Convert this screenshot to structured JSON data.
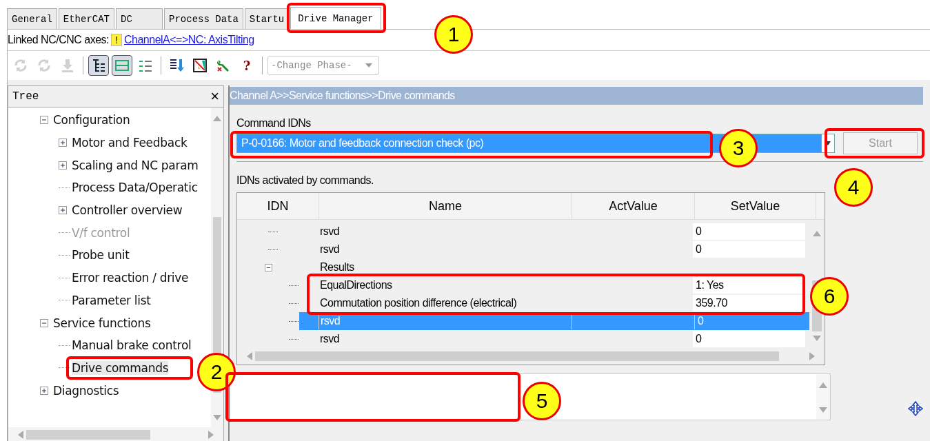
{
  "tabs": [
    {
      "label": "General",
      "selected": false
    },
    {
      "label": "EtherCAT",
      "selected": false
    },
    {
      "label": "DC",
      "selected": false
    },
    {
      "label": "Process Data",
      "selected": false
    },
    {
      "label": "Startu",
      "selected": false
    },
    {
      "label": "Drive Manager",
      "selected": true
    }
  ],
  "linked": {
    "label": "Linked NC/CNC axes:",
    "badge": "!",
    "link": "ChannelA<=>NC: AxisTilting"
  },
  "toolbar": {
    "buttons": [
      {
        "kind": "refresh",
        "disabled": true
      },
      {
        "kind": "reload",
        "disabled": true
      },
      {
        "kind": "download",
        "disabled": true
      },
      {
        "kind": "sep"
      },
      {
        "kind": "tree",
        "disabled": false,
        "pressed": true
      },
      {
        "kind": "list",
        "disabled": false,
        "pressed": true
      },
      {
        "kind": "checklist",
        "disabled": false
      },
      {
        "kind": "sep"
      },
      {
        "kind": "sort",
        "disabled": false
      },
      {
        "kind": "chart",
        "disabled": false
      },
      {
        "kind": "wrench",
        "disabled": false
      },
      {
        "kind": "help",
        "label": "?",
        "disabled": false
      },
      {
        "kind": "sep"
      }
    ],
    "phase": {
      "placeholder": "-Change Phase-",
      "disabled": true
    }
  },
  "tree": {
    "title": "Tree",
    "close": "×",
    "items": [
      {
        "label": "Configuration",
        "expanded": true,
        "children": [
          {
            "label": "Motor and Feedback",
            "expanded": false
          },
          {
            "label": "Scaling and NC param",
            "expanded": false
          },
          {
            "label": "Process Data/Operatic"
          },
          {
            "label": "Controller overview",
            "expanded": false
          },
          {
            "label": "V/f control",
            "disabled": true
          },
          {
            "label": "Probe unit"
          },
          {
            "label": "Error reaction / drive"
          },
          {
            "label": "Parameter list"
          }
        ]
      },
      {
        "label": "Service functions",
        "expanded": true,
        "children": [
          {
            "label": "Manual brake control",
            "selected": false
          },
          {
            "label": "Drive commands",
            "selected": true
          }
        ]
      },
      {
        "label": "Diagnostics",
        "expanded": false
      }
    ]
  },
  "panel": {
    "breadcrumb": "Channel A>>Service functions>>Drive commands",
    "command_label": "Command IDNs",
    "command_value": "P-0-0166: Motor and feedback connection check (pc)",
    "start": {
      "label": "Start",
      "disabled": true
    },
    "idns_label": "IDNs activated by commands.",
    "table": {
      "columns": [
        "IDN",
        "Name",
        "ActValue",
        "SetValue"
      ],
      "rows": [
        {
          "name": "rsvd",
          "set_value": "0",
          "selected": false
        },
        {
          "name": "rsvd",
          "set_value": "0",
          "selected": false
        },
        {
          "name": "Results",
          "expanded": true,
          "selected": false,
          "children": [
            {
              "name": "EqualDirections",
              "set_value": "1: Yes",
              "selected": false
            },
            {
              "name": "Commutation position difference (electrical)",
              "set_value": "359.70",
              "selected": false
            },
            {
              "name": "rsvd",
              "set_value": "0",
              "selected": true
            },
            {
              "name": "rsvd",
              "set_value": "0",
              "selected": false
            }
          ]
        }
      ]
    }
  },
  "callouts": [
    {
      "number": "1"
    },
    {
      "number": "2"
    },
    {
      "number": "3"
    },
    {
      "number": "4"
    },
    {
      "number": "5"
    },
    {
      "number": "6"
    }
  ]
}
